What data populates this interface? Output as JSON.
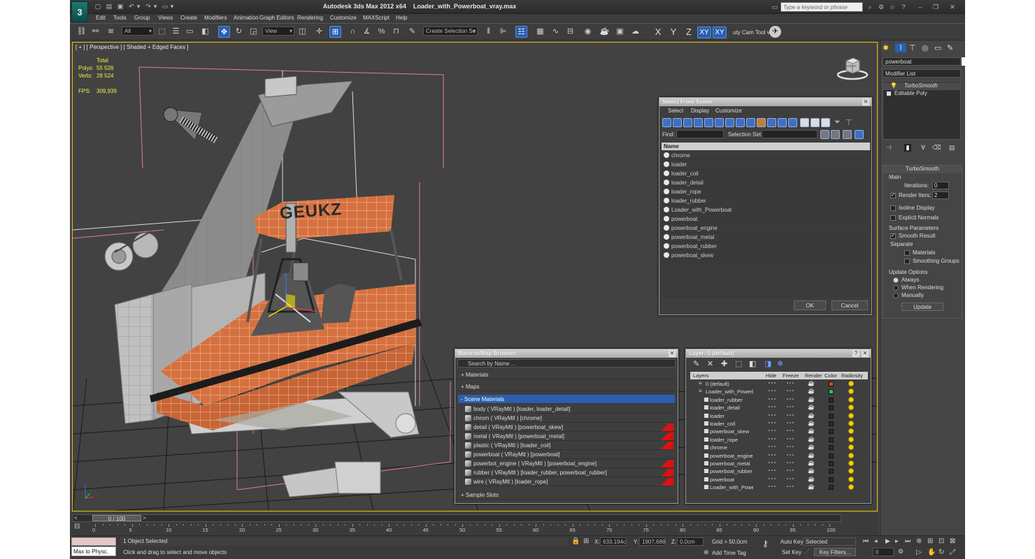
{
  "app": {
    "title": "Autodesk 3ds Max  2012 x64",
    "file": "Loader_with_Powerboat_vray.max",
    "search_placeholder": "Type a keyword or phrase",
    "logo": "3"
  },
  "menu": [
    "Edit",
    "Tools",
    "Group",
    "Views",
    "Create",
    "Modifiers",
    "Animation",
    "Graph Editors",
    "Rendering",
    "Customize",
    "MAXScript",
    "Help"
  ],
  "toolbar": {
    "filter_dropdown": "All",
    "refcoord_dropdown": "View",
    "selection_set": "Create Selection Se",
    "axis_x": "X",
    "axis_y": "Y",
    "axis_z": "Z",
    "axis_xy": "XY",
    "axis_xy2": "XY",
    "ext_tool": "uty Cam Tool v"
  },
  "viewport": {
    "label": "[ + ] [ Perspective ] [ Shaded + Edged Faces ]",
    "stats": {
      "total_label": "Total",
      "polys_label": "Polys:",
      "polys": "55 526",
      "verts_label": "Verts:",
      "verts": "28 524",
      "fps_label": "FPS:",
      "fps": "309,939"
    },
    "boat_text": "GEUKZ",
    "viewcube_label": "FRONT"
  },
  "select_from_scene": {
    "title": "Select From Scene",
    "menu": [
      "Select",
      "Display",
      "Customize"
    ],
    "find_label": "Find:",
    "selection_set_label": "Selection Set:",
    "column": "Name",
    "items": [
      "chrome",
      "loader",
      "loader_coil",
      "loader_detail",
      "loader_rope",
      "loader_rubber",
      "Loader_with_Powerboat",
      "powerboat",
      "powerboat_engine",
      "powerboat_metal",
      "powerboat_rubber",
      "powerboat_skew"
    ],
    "ok": "OK",
    "cancel": "Cancel"
  },
  "material_browser": {
    "title": "Material/Map Browser",
    "search_placeholder": "Search by Name ...",
    "sections": {
      "materials": "+ Materials",
      "maps": "+ Maps",
      "scene": "- Scene Materials",
      "samples": "+ Sample Slots"
    },
    "items": [
      "body  ( VRayMtl )  [loader, loader_detail]",
      "chrom  ( VRayMtl )  [chrome]",
      "detail  ( VRayMtl )  [powerboat_skew]",
      "metal  ( VRayMtl )  [powerboat_metal]",
      "plastic  ( VRayMtl )  [loader_coil]",
      "powerboat  ( VRayMtl )  [powerboat]",
      "powerbot_engine  ( VRayMtl )  [powerboat_engine]",
      "rubber  ( VRayMtl )  [loader_rubber, powerboat_rubber]",
      "wire  ( VRayMtl )  [loader_rope]"
    ],
    "flagged": [
      false,
      false,
      true,
      true,
      true,
      false,
      true,
      true,
      true
    ]
  },
  "layer_manager": {
    "title": "Layer: 0 (default)",
    "help": "?",
    "columns": [
      "Layers",
      "Hide",
      "Freeze",
      "Render",
      "Color",
      "Radiosity"
    ],
    "rows": [
      {
        "name": "0 (default)",
        "indent": 0,
        "color": "#d0501c"
      },
      {
        "name": "Loader_with_Powerboat",
        "indent": 0,
        "color": "#2ec84a"
      },
      {
        "name": "loader_rubber",
        "indent": 1
      },
      {
        "name": "loader_detail",
        "indent": 1
      },
      {
        "name": "loader",
        "indent": 1
      },
      {
        "name": "loader_coil",
        "indent": 1
      },
      {
        "name": "powerboat_skew",
        "indent": 1
      },
      {
        "name": "loader_rope",
        "indent": 1
      },
      {
        "name": "chrome",
        "indent": 1
      },
      {
        "name": "powerboat_engine",
        "indent": 1
      },
      {
        "name": "powerboat_metal",
        "indent": 1
      },
      {
        "name": "powerboat_rubber",
        "indent": 1
      },
      {
        "name": "powerboat",
        "indent": 1
      },
      {
        "name": "Loader_with_Powerboat",
        "indent": 1
      }
    ]
  },
  "command_panel": {
    "object_name": "powerboat",
    "modifier_list": "Modifier List",
    "stack": [
      "TurboSmooth",
      "Editable Poly"
    ],
    "rollout": "TurboSmooth",
    "main_label": "Main",
    "iterations_label": "Iterations:",
    "iterations": "0",
    "render_iters_label": "Render Iters:",
    "render_iters": "2",
    "isoline": "Isoline Display",
    "explicit": "Explicit Normals",
    "surface_params": "Surface Parameters",
    "smooth_result": "Smooth Result",
    "separate": "Separate",
    "materials": "Materials",
    "smoothing_groups": "Smoothing Groups",
    "update_options": "Update Options",
    "always": "Always",
    "when_rendering": "When Rendering",
    "manually": "Manually",
    "update_btn": "Update"
  },
  "timeline": {
    "frame": "0 / 100",
    "ticks": [
      "0",
      "5",
      "10",
      "15",
      "20",
      "25",
      "30",
      "35",
      "40",
      "45",
      "50",
      "55",
      "60",
      "65",
      "70",
      "75",
      "80",
      "85",
      "90",
      "95",
      "100"
    ]
  },
  "status": {
    "maxscript": "Max to Physc.",
    "selected": "1 Object Selected",
    "prompt": "Click and drag to select and move objects",
    "x_label": "X:",
    "x": "633,194cm",
    "y_label": "Y:",
    "y": "1907,688c",
    "z_label": "Z:",
    "z": "0,0cm",
    "grid": "Grid = 50,0cm",
    "add_time_tag": "Add Time Tag",
    "auto_key": "Auto Key",
    "set_key": "Set Key",
    "key_mode": "Selected",
    "key_filters": "Key Filters...",
    "frame": "0"
  },
  "colors": {
    "accent": "#2b5fae",
    "viewport_border": "#e8c400",
    "stat_text": "#f2ee4a",
    "boat_orange": "#d6713f"
  }
}
